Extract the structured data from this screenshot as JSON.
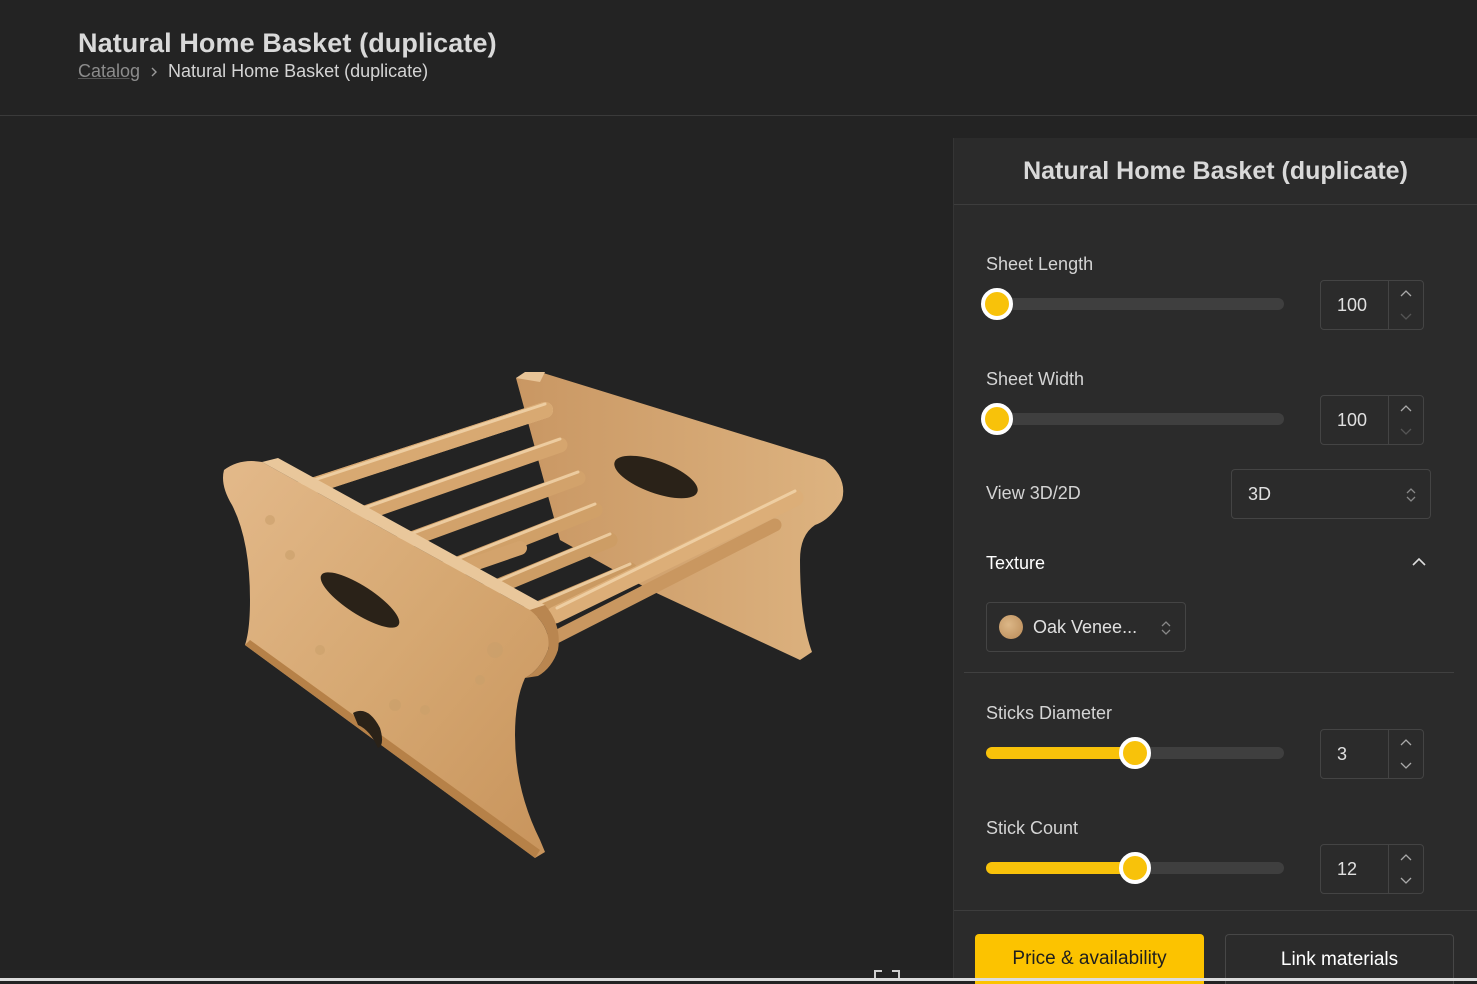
{
  "header": {
    "title": "Natural Home Basket (duplicate)",
    "breadcrumb": {
      "root": "Catalog",
      "current": "Natural Home Basket (duplicate)",
      "separator_icon": "chevron-right-icon"
    }
  },
  "viewer": {
    "fullscreen_icon": "fullscreen-icon"
  },
  "panel": {
    "title": "Natural Home Basket (duplicate)",
    "sheet_length": {
      "label": "Sheet Length",
      "value": "100",
      "slider_fraction": 0.0
    },
    "sheet_width": {
      "label": "Sheet Width",
      "value": "100",
      "slider_fraction": 0.0
    },
    "view_mode": {
      "label": "View 3D/2D",
      "value": "3D"
    },
    "texture": {
      "title": "Texture",
      "value": "Oak Venee...",
      "expanded": true
    },
    "sticks_diameter": {
      "label": "Sticks Diameter",
      "value": "3",
      "slider_fraction": 0.5
    },
    "stick_count": {
      "label": "Stick Count",
      "value": "12",
      "slider_fraction": 0.5
    },
    "price_button": "Price & availability",
    "link_button": "Link materials"
  },
  "colors": {
    "accent": "#fcc300",
    "background": "#232323",
    "panel": "#2b2b2b",
    "wood": "#d4a56a"
  }
}
